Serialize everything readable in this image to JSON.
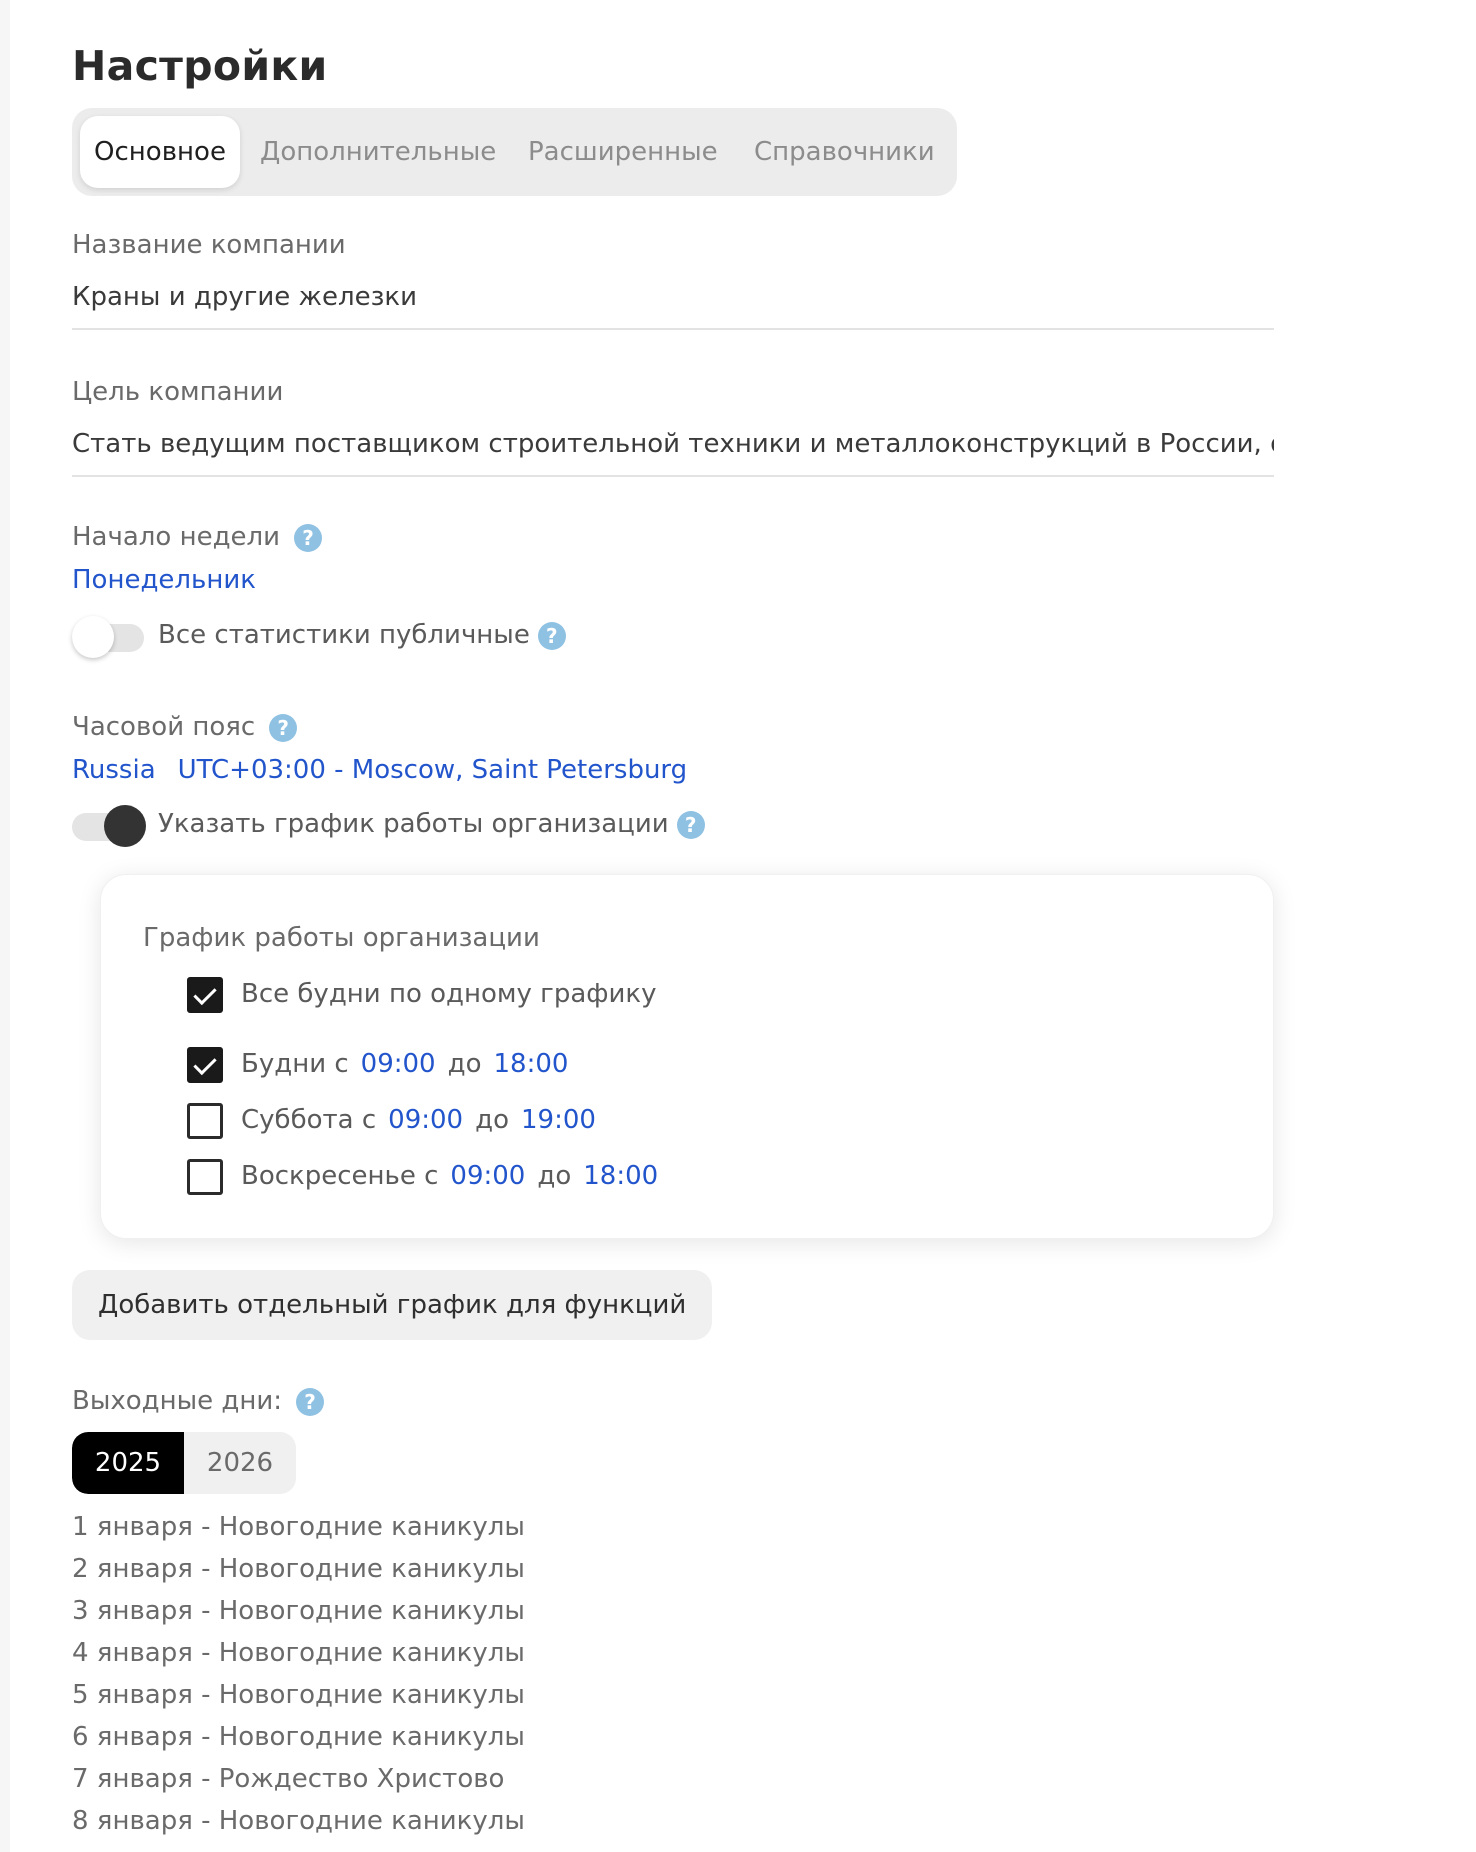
{
  "page": {
    "title": "Настройки"
  },
  "tabs": [
    {
      "label": "Основное",
      "active": true
    },
    {
      "label": "Дополнительные",
      "active": false
    },
    {
      "label": "Расширенные",
      "active": false
    },
    {
      "label": "Справочники",
      "active": false
    }
  ],
  "company": {
    "name_label": "Название компании",
    "name_value": "Краны и другие железки",
    "goal_label": "Цель компании",
    "goal_value": "Стать ведущим поставщиком строительной техники и металлоконструкций в России, об"
  },
  "week": {
    "label": "Начало недели",
    "value": "Понедельник"
  },
  "public_stats": {
    "label": "Все статистики публичные",
    "enabled": false
  },
  "timezone": {
    "label": "Часовой пояс",
    "country": "Russia",
    "zone": "UTC+03:00 - Moscow, Saint Petersburg"
  },
  "work_schedule_toggle": {
    "label": "Указать график работы организации",
    "enabled": true
  },
  "schedule": {
    "title": "График работы организации",
    "same_weekdays": {
      "label": "Все будни по одному графику",
      "checked": true
    },
    "to_label": "до",
    "rows": [
      {
        "label": "Будни с",
        "from": "09:00",
        "to": "18:00",
        "checked": true
      },
      {
        "label": "Суббота с",
        "from": "09:00",
        "to": "19:00",
        "checked": false
      },
      {
        "label": "Воскресенье с",
        "from": "09:00",
        "to": "18:00",
        "checked": false
      }
    ]
  },
  "add_schedule_button": "Добавить отдельный график для функций",
  "holidays": {
    "label": "Выходные дни:",
    "years": [
      {
        "label": "2025",
        "active": true
      },
      {
        "label": "2026",
        "active": false
      }
    ],
    "items": [
      "1 января - Новогодние каникулы",
      "2 января - Новогодние каникулы",
      "3 января - Новогодние каникулы",
      "4 января - Новогодние каникулы",
      "5 января - Новогодние каникулы",
      "6 января - Новогодние каникулы",
      "7 января - Рождество Христово",
      "8 января - Новогодние каникулы"
    ]
  },
  "icons": {
    "help": "question-circle-icon",
    "check": "checkmark-icon"
  },
  "colors": {
    "link": "#2255cc",
    "help_icon": "#8fc1e3",
    "active_year_bg": "#000000",
    "toggle_on_knob": "#333333"
  }
}
